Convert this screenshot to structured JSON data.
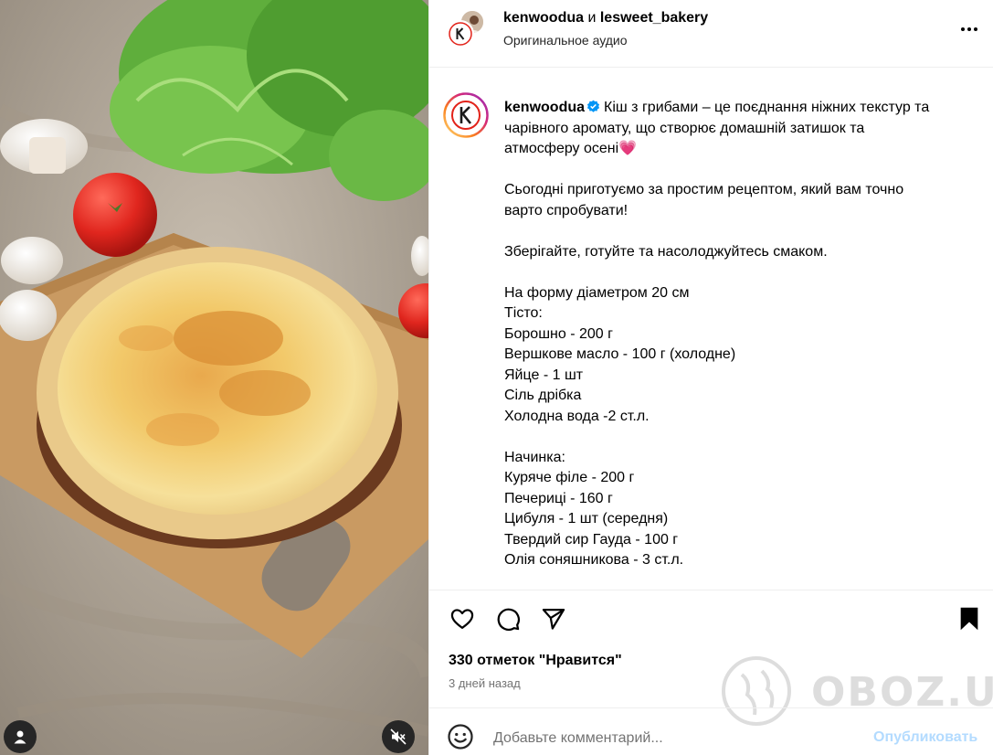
{
  "post": {
    "authors": {
      "primary": "kenwoodua",
      "connector": "и",
      "secondary": "lesweet_bakery"
    },
    "audio": "Оригинальное аудио"
  },
  "caption": {
    "username": "kenwoodua",
    "lines": [
      "Кіш з грибами – це поєднання ніжних текстур та",
      "чарівного аромату, що створює домашній затишок та",
      "атмосферу осені",
      "",
      "Сьогодні приготуємо за простим рецептом, який вам точно",
      "варто спробувати!",
      "",
      "Зберігайте, готуйте та насолоджуйтесь смаком.",
      "",
      "На форму діаметром 20 см",
      "Тісто:",
      "Борошно - 200 г",
      "Вершкове масло - 100 г (холодне)",
      "Яйце - 1 шт",
      "Сіль дрібка",
      "Холодна вода -2 ст.л.",
      "",
      "Начинка:",
      "Куряче філе - 200 г",
      "Печериці - 160 г",
      "Цибуля - 1 шт (середня)",
      "Твердий сир Гауда - 100 г",
      "Олія соняшникова - 3 ст.л."
    ],
    "heart_emoji": "💗"
  },
  "engagement": {
    "likes": "330 отметок \"Нравится\"",
    "time_ago": "3 дней назад"
  },
  "comment": {
    "placeholder": "Добавьте комментарий...",
    "publish_label": "Опубликовать"
  },
  "watermark": {
    "text": "OBOZ.UA"
  },
  "icons": {
    "more": "more-options-icon",
    "like": "heart-icon",
    "comment": "comment-icon",
    "share": "send-icon",
    "save": "bookmark-icon",
    "emoji": "emoji-icon",
    "user_tag": "user-tag-icon",
    "mute": "muted-icon",
    "verified": "verified-badge-icon"
  },
  "colors": {
    "accent_blue": "#0095f6",
    "publish_disabled": "#b3dbff",
    "secondary_text": "#737373",
    "kenwood_red": "#e2231a"
  }
}
